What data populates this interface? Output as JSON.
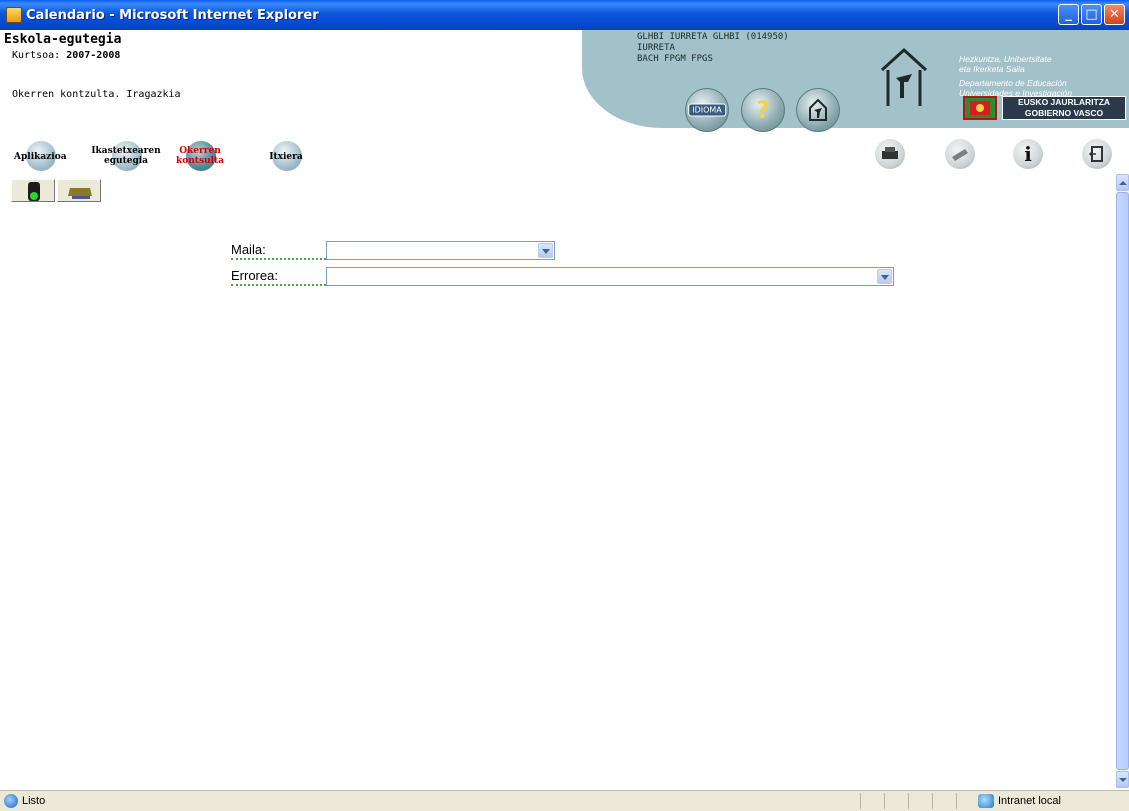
{
  "window": {
    "title": "Calendario - Microsoft Internet Explorer",
    "minimize": "_",
    "maximize": "□",
    "close": "✕"
  },
  "header": {
    "app_name": "Eskola-egutegia",
    "course_label": "Kurtsoa:",
    "course_value": "2007-2008",
    "subtitle": "Okerren kontzulta. Iragazkia"
  },
  "banner": {
    "school_line1": "GLHBI IURRETA GLHBI (014950)",
    "school_line2": "IURRETA",
    "school_line3": "BACH FPGM FPGS",
    "dept_line1": "Hezkuntza, Unibertsitate",
    "dept_line2": "eta Ikerketa Saila",
    "dept_line3": "Departamento de Educación",
    "dept_line4": "Universidades e Investigación",
    "btn_idioma": "IDIOMA",
    "btn_help": "?",
    "gv_line1": "EUSKO JAURLARITZA",
    "gv_line2": "GOBIERNO VASCO"
  },
  "nav": {
    "aplikazioa": "Aplikazioa",
    "ikastetxearen_1": "Ikastetxearen",
    "ikastetxearen_2": "egutegia",
    "okerren_1": "Okerren",
    "okerren_2": "kontsulta",
    "itxiera": "Itxiera"
  },
  "right_icons": {
    "info": "i"
  },
  "form": {
    "maila_label": "Maila:",
    "maila_value": "",
    "errorea_label": "Errorea:",
    "errorea_value": ""
  },
  "status": {
    "text": "Listo",
    "zone": "Intranet local"
  }
}
